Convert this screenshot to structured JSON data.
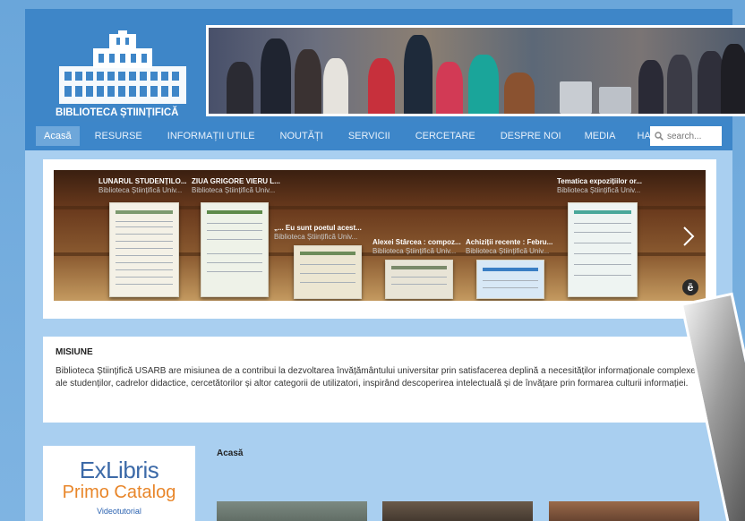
{
  "header": {
    "logo_text": "BIBLIOTECA ȘTIINȚIFICĂ"
  },
  "nav": {
    "items": [
      "Acasă",
      "RESURSE",
      "INFORMAȚII UTILE",
      "NOUTĂȚI",
      "SERVICII",
      "CERCETARE",
      "DESPRE NOI",
      "MEDIA",
      "HARTA"
    ],
    "active": "Acasă"
  },
  "search": {
    "placeholder": "search..."
  },
  "carousel": {
    "slides": [
      {
        "title": "LUNARUL STUDENȚILO...",
        "sub": "Biblioteca Științifică Univ..."
      },
      {
        "title": "ZIUA GRIGORE VIERU L...",
        "sub": "Biblioteca Științifică Univ..."
      },
      {
        "title": "„... Eu sunt poetul acest...",
        "sub": "Biblioteca Științifică Univ..."
      },
      {
        "title": "Alexei Stârcea : compoz...",
        "sub": "Biblioteca Științifică Univ..."
      },
      {
        "title": "Achiziții recente : Febru...",
        "sub": "Biblioteca Științifică Univ..."
      },
      {
        "title": "Tematica expozițiilor or...",
        "sub": "Biblioteca Științifică Univ..."
      }
    ],
    "badge": "ē"
  },
  "mission": {
    "title": "MISIUNE",
    "text": "Biblioteca Științifică USARB are misiunea de a contribui la dezvoltarea învățământului universitar prin satisfacerea deplină a necesităților informaționale complexe ale studenților, cadrelor didactice, cercetătorilor și altor categorii de utilizatori, inspirând descoperirea intelectuală și de învățare prin formarea culturii informației."
  },
  "exlibris": {
    "logo": "ExLibris",
    "primo": "Primo Catalog",
    "video": "Videotutorial"
  },
  "home_heading": "Acasă",
  "colors": {
    "nav_bg": "#3d86c9",
    "content_bg": "#a9cff0",
    "primo_orange": "#e8862a",
    "exlibris_blue": "#3c6aa8"
  }
}
